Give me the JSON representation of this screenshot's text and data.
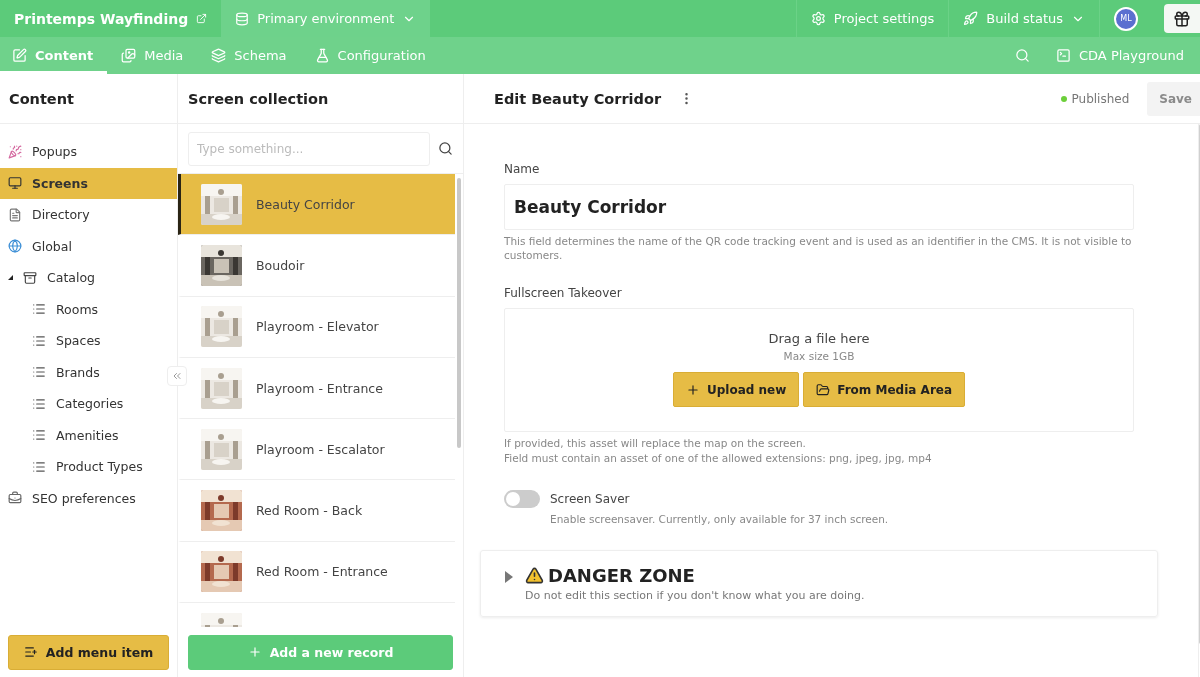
{
  "topbar": {
    "project": "Printemps Wayfinding",
    "environment": "Primary environment",
    "actions": [
      {
        "kind": "settings",
        "label": "Project settings"
      },
      {
        "kind": "build",
        "label": "Build status"
      }
    ],
    "avatar": "ML"
  },
  "nav": {
    "tabs": [
      {
        "kind": "content",
        "label": "Content",
        "selected": true
      },
      {
        "kind": "media",
        "label": "Media",
        "selected": false
      },
      {
        "kind": "schema",
        "label": "Schema",
        "selected": false
      },
      {
        "kind": "config",
        "label": "Configuration",
        "selected": false
      }
    ],
    "playground": "CDA Playground"
  },
  "sidebar": {
    "title": "Content",
    "items": [
      {
        "kind": "popup",
        "label": "Popups",
        "selected": false
      },
      {
        "kind": "screen",
        "label": "Screens",
        "selected": true
      },
      {
        "kind": "doc",
        "label": "Directory",
        "selected": false
      },
      {
        "kind": "globe",
        "label": "Global",
        "selected": false
      },
      {
        "kind": "folder",
        "label": "Catalog",
        "selected": false,
        "expanded": true,
        "children": [
          {
            "label": "Rooms",
            "selected": false
          },
          {
            "label": "Spaces",
            "selected": false
          },
          {
            "label": "Brands",
            "selected": false
          },
          {
            "label": "Categories",
            "selected": false
          },
          {
            "label": "Amenities",
            "selected": false
          },
          {
            "label": "Product Types",
            "selected": false
          }
        ]
      },
      {
        "kind": "seo",
        "label": "SEO preferences",
        "selected": false
      }
    ],
    "add_button": "Add menu item"
  },
  "collection": {
    "title": "Screen collection",
    "search_placeholder": "Type something...",
    "records": [
      {
        "title": "Beauty Corridor",
        "kind": "light",
        "selected": true
      },
      {
        "title": "Boudoir",
        "kind": "dark",
        "selected": false
      },
      {
        "title": "Playroom - Elevator",
        "kind": "light",
        "selected": false
      },
      {
        "title": "Playroom - Entrance",
        "kind": "light",
        "selected": false
      },
      {
        "title": "Playroom - Escalator",
        "kind": "light",
        "selected": false
      },
      {
        "title": "Red Room - Back",
        "kind": "red",
        "selected": false
      },
      {
        "title": "Red Room - Entrance",
        "kind": "red",
        "selected": false
      },
      {
        "kind": "light",
        "selected": false
      }
    ],
    "add_button": "Add a new record"
  },
  "editor": {
    "title": "Edit Beauty Corridor",
    "status": "Published",
    "save": "Save",
    "fields": [
      {
        "kind": "text",
        "label": "Name",
        "value": "Beauty Corridor",
        "hint": "This field determines the name of the QR code tracking event and is used as an identifier in the CMS. It is not visible to customers."
      },
      {
        "kind": "file",
        "label": "Fullscreen Takeover",
        "drop": "Drag a file here",
        "max": "Max size 1GB",
        "upload": "Upload new",
        "media": "From Media Area",
        "hints": [
          "If provided, this asset will replace the map on the screen.",
          "Field must contain an asset of one of the allowed extensions: png, jpeg, jpg, mp4"
        ]
      },
      {
        "kind": "switch",
        "label": "Screen Saver",
        "on": false,
        "hint": "Enable screensaver. Currently, only available for 37 inch screen."
      }
    ],
    "danger": {
      "title": "DANGER ZONE",
      "text": "Do not edit this section if you don't know what you are doing.",
      "expanded": false
    }
  }
}
